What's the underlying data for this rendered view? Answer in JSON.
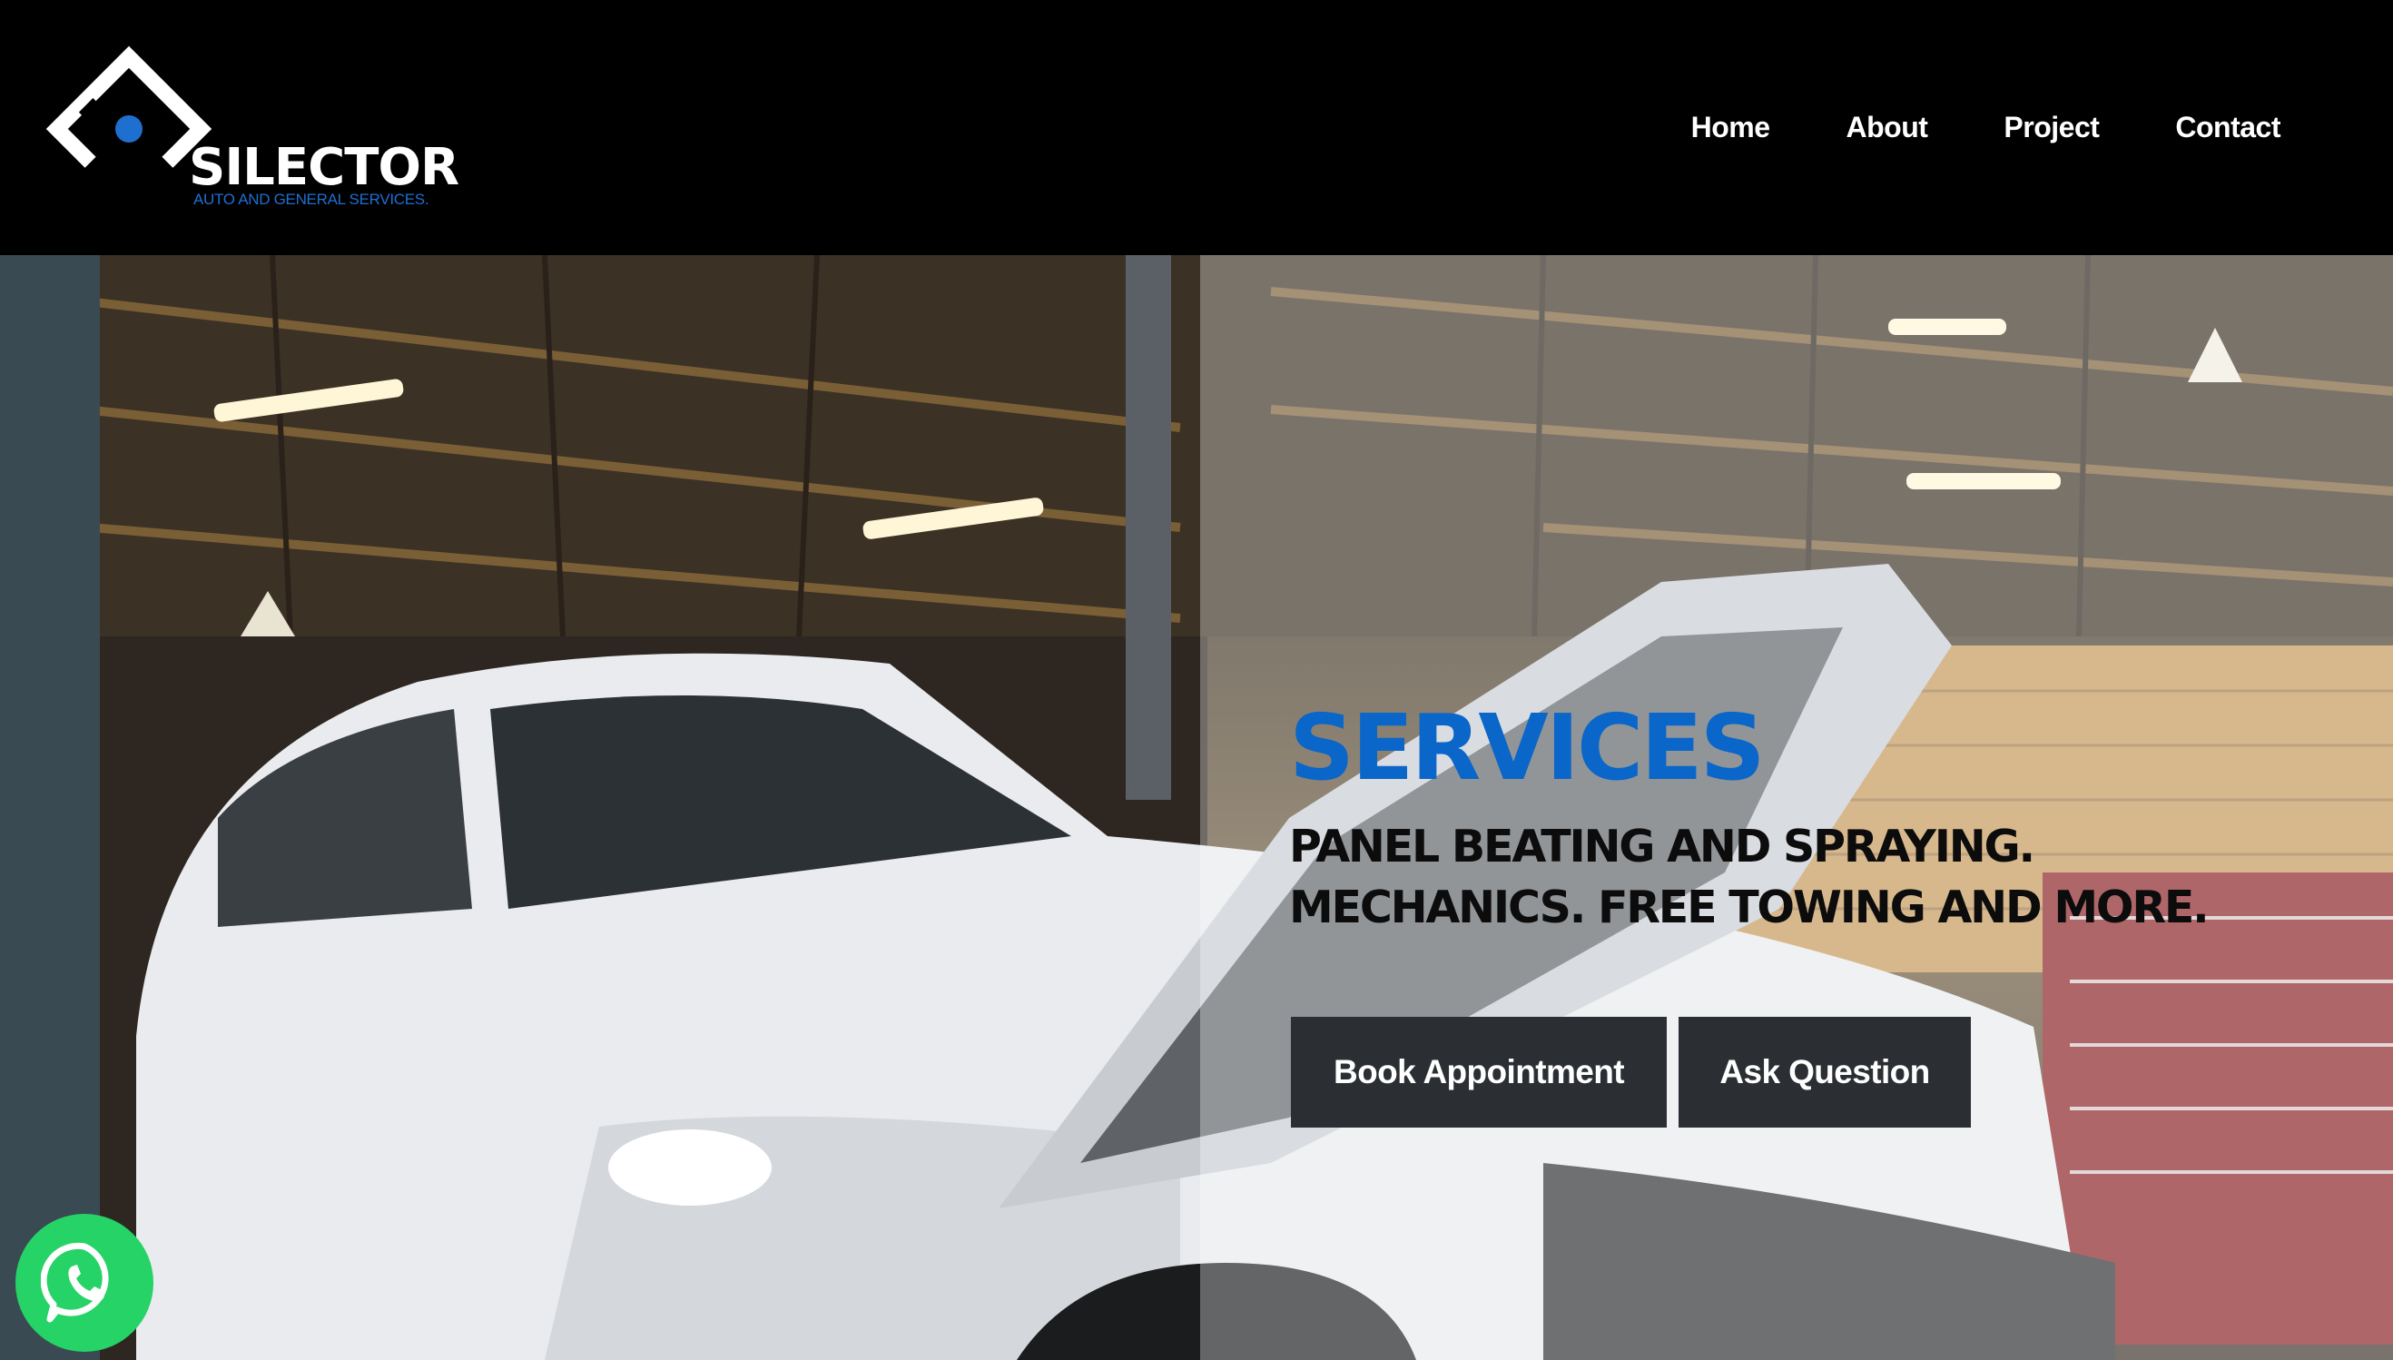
{
  "brand": {
    "name": "SILECTOR",
    "tagline": "AUTO AND GENERAL SERVICES.",
    "logo_icon": "diamond-logo-icon",
    "accent_color": "#0a66c8"
  },
  "nav": {
    "items": [
      {
        "label": "Home"
      },
      {
        "label": "About"
      },
      {
        "label": "Project"
      },
      {
        "label": "Contact"
      }
    ]
  },
  "hero": {
    "title": "SERVICES",
    "subtitle_line1": "PANEL BEATING AND SPRAYING.",
    "subtitle_line2": "MECHANICS. FREE TOWING AND MORE.",
    "background_image": "white SUV with open hood in workshop",
    "buttons": {
      "book": "Book Appointment",
      "ask": "Ask Question"
    }
  },
  "whatsapp": {
    "icon": "whatsapp-icon",
    "color": "#25d366"
  }
}
